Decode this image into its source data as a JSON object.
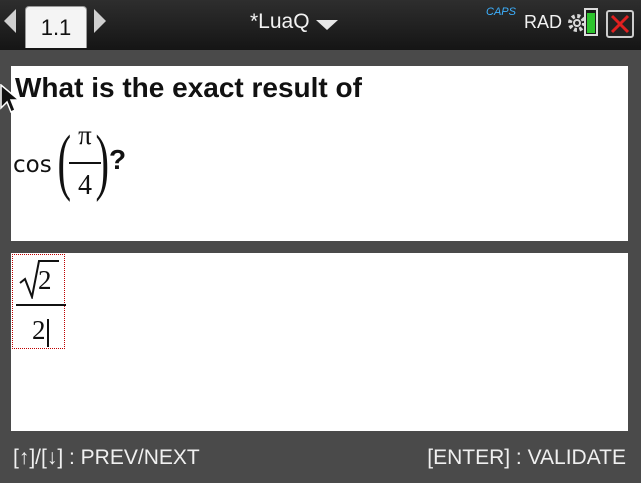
{
  "tabs": [
    {
      "label": "1.1"
    }
  ],
  "document": {
    "title": "*LuaQ"
  },
  "status": {
    "caps": "CAPS",
    "angle_mode": "RAD",
    "battery_level": 0.85
  },
  "question": {
    "text": "What is the exact result of",
    "expression": {
      "function": "cos",
      "numerator": "π",
      "denominator": "4"
    },
    "suffix": "?"
  },
  "answer": {
    "radicand": "2",
    "denominator": "2"
  },
  "footer": {
    "left": "[↑]/[↓] : PREV/NEXT",
    "right": "[ENTER] : VALIDATE"
  },
  "colors": {
    "caps": "#3db1ff",
    "battery": "#2ec42e",
    "input_border": "#c00000"
  }
}
